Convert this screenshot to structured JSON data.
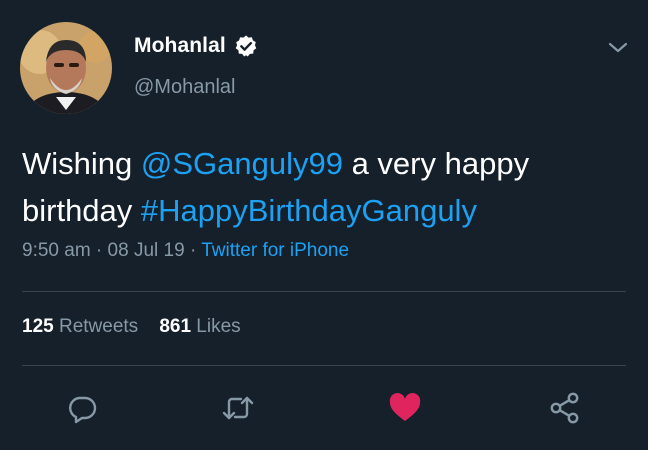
{
  "user": {
    "name": "Mohanlal",
    "handle": "@Mohanlal",
    "verified": true,
    "avatar_icon": "profile-photo"
  },
  "tweet": {
    "text_before": "Wishing ",
    "mention": "@SGanguly99",
    "text_middle": " a very happy birthday ",
    "hashtag": "#HappyBirthdayGanguly"
  },
  "meta": {
    "time": "9:50 am",
    "separator1": " · ",
    "date": "08 Jul 19",
    "separator2": " · ",
    "source": "Twitter for iPhone"
  },
  "stats": {
    "retweets_count": "125",
    "retweets_label": "Retweets",
    "likes_count": "861",
    "likes_label": "Likes"
  },
  "actions": [
    {
      "name": "reply",
      "icon": "reply-icon"
    },
    {
      "name": "retweet",
      "icon": "retweet-icon"
    },
    {
      "name": "like",
      "icon": "heart-icon",
      "active": true
    },
    {
      "name": "share",
      "icon": "share-icon"
    }
  ],
  "colors": {
    "background": "#15202b",
    "accent": "#1da1f2",
    "secondary_text": "#8899a6",
    "like": "#e0245e"
  }
}
